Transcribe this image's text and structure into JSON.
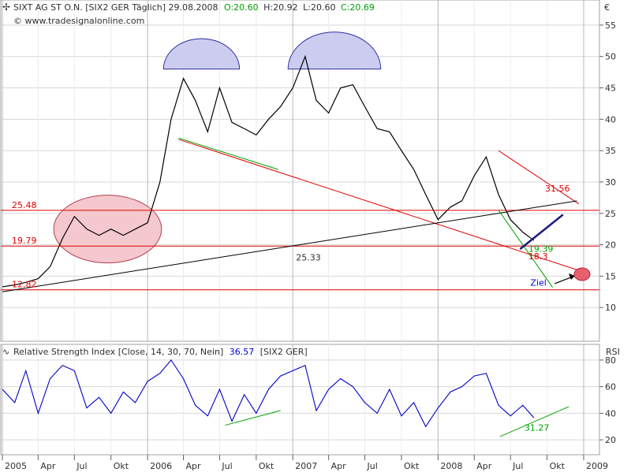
{
  "header": {
    "icon": "cross-cursor-icon",
    "title": "SIXT AG ST O.N. [SIX2 GER  Täglich] 29.08.2008",
    "ohlc": [
      {
        "text": "O:20.60",
        "color": "#00a000"
      },
      {
        "text": "H:20.92",
        "color": "#303030"
      },
      {
        "text": "L:20.60",
        "color": "#303030"
      },
      {
        "text": "C:20.69",
        "color": "#00a000"
      }
    ],
    "source": "© www.tradesignalonline.com",
    "currency": "€"
  },
  "price_axis": {
    "ticks": [
      10,
      15,
      20,
      25,
      30,
      35,
      40,
      45,
      50,
      55
    ]
  },
  "rsi_header": {
    "icon": "indicator-icon",
    "title": "Relative Strength Index [Close, 14, 30, 70, Nein]",
    "value": "36.57",
    "symbol": "[SIX2 GER]",
    "axis_title": "RSI"
  },
  "rsi_axis": {
    "ticks": [
      20,
      40,
      60,
      80
    ]
  },
  "time_axis": {
    "labels": [
      "2005",
      "Apr",
      "Jul",
      "Okt",
      "2006",
      "Apr",
      "Jul",
      "Okt",
      "2007",
      "Apr",
      "Jul",
      "Okt",
      "2008",
      "Apr",
      "Jul",
      "Okt",
      "2009"
    ]
  },
  "colors": {
    "price": "#000000",
    "rsi": "#0000c8",
    "support": "#e00000",
    "trend": "#00a000",
    "ellipse": "#f4c8cc",
    "cap": "#ccccf0"
  },
  "chart_data": [
    {
      "type": "line",
      "title": "SIXT AG ST O.N. [SIX2 GER  Täglich] 29.08.2008",
      "x_range": [
        "2005-01-01",
        "2009-01-01"
      ],
      "ylim": [
        5,
        58
      ],
      "series": [
        {
          "name": "SIXT AG ST O.N.",
          "points": [
            [
              "2005-01-01",
              13.3
            ],
            [
              "2005-02-01",
              13.6
            ],
            [
              "2005-03-01",
              14.0
            ],
            [
              "2005-04-01",
              14.6
            ],
            [
              "2005-05-01",
              16.5
            ],
            [
              "2005-06-01",
              21.0
            ],
            [
              "2005-07-01",
              24.5
            ],
            [
              "2005-08-01",
              22.5
            ],
            [
              "2005-09-01",
              21.5
            ],
            [
              "2005-10-01",
              22.5
            ],
            [
              "2005-11-01",
              21.5
            ],
            [
              "2005-12-01",
              22.5
            ],
            [
              "2006-01-01",
              23.5
            ],
            [
              "2006-02-01",
              30.0
            ],
            [
              "2006-03-01",
              40.0
            ],
            [
              "2006-04-01",
              46.5
            ],
            [
              "2006-05-01",
              43.0
            ],
            [
              "2006-06-01",
              38.0
            ],
            [
              "2006-07-01",
              45.0
            ],
            [
              "2006-08-01",
              39.5
            ],
            [
              "2006-09-01",
              38.5
            ],
            [
              "2006-10-01",
              37.5
            ],
            [
              "2006-11-01",
              40.0
            ],
            [
              "2006-12-01",
              42.0
            ],
            [
              "2007-01-01",
              45.0
            ],
            [
              "2007-02-01",
              50.0
            ],
            [
              "2007-03-01",
              43.0
            ],
            [
              "2007-04-01",
              41.0
            ],
            [
              "2007-05-01",
              45.0
            ],
            [
              "2007-06-01",
              45.5
            ],
            [
              "2007-07-01",
              42.0
            ],
            [
              "2007-08-01",
              38.5
            ],
            [
              "2007-09-01",
              38.0
            ],
            [
              "2007-10-01",
              35.0
            ],
            [
              "2007-11-01",
              32.0
            ],
            [
              "2007-12-01",
              28.0
            ],
            [
              "2008-01-01",
              24.0
            ],
            [
              "2008-02-01",
              26.0
            ],
            [
              "2008-03-01",
              27.0
            ],
            [
              "2008-04-01",
              31.0
            ],
            [
              "2008-05-01",
              34.0
            ],
            [
              "2008-06-01",
              28.0
            ],
            [
              "2008-07-01",
              24.0
            ],
            [
              "2008-08-01",
              22.0
            ],
            [
              "2008-08-29",
              20.69
            ]
          ]
        }
      ],
      "horizontal_lines": [
        {
          "value": 25.48,
          "label": "25.48",
          "color": "#e00000"
        },
        {
          "value": 19.79,
          "label": "19.79",
          "color": "#e00000"
        },
        {
          "value": 12.82,
          "label": "12.82",
          "color": "#e00000"
        }
      ],
      "trend_lines": [
        {
          "from": [
            "2008-06-01",
            35.0
          ],
          "to": [
            "2008-12-20",
            26.5
          ],
          "label": "31.56",
          "color": "#e00000"
        },
        {
          "from": [
            "2006-03-20",
            36.8
          ],
          "to": [
            "2008-12-25",
            15.8
          ],
          "color": "#e00000"
        },
        {
          "from": [
            "2005-01-01",
            12.5
          ],
          "to": [
            "2008-12-15",
            27.0
          ],
          "label": "25.33",
          "color": "#000000"
        },
        {
          "from": [
            "2006-03-20",
            37.0
          ],
          "to": [
            "2006-11-25",
            32.0
          ],
          "color": "#00a000"
        },
        {
          "from": [
            "2008-06-01",
            25.5
          ],
          "to": [
            "2008-10-15",
            13.2
          ],
          "color": "#00a000"
        },
        {
          "from": [
            "2008-07-25",
            19.3
          ],
          "to": [
            "2008-11-10",
            24.8
          ],
          "color": "#1a1a80"
        }
      ],
      "annotations": [
        {
          "text": "19.39",
          "x": "2008-08-15",
          "y": 19.4,
          "color": "#00a000"
        },
        {
          "text": "18.3",
          "x": "2008-08-15",
          "y": 18.2,
          "color": "#e00000"
        },
        {
          "text": "Ziel",
          "x": "2008-08-20",
          "y": 14.0,
          "color": "#0000c8"
        }
      ]
    },
    {
      "type": "line",
      "title": "Relative Strength Index [Close, 14, 30, 70, Nein]",
      "ylim": [
        10,
        90
      ],
      "series": [
        {
          "name": "RSI",
          "points": [
            [
              "2005-01-01",
              58
            ],
            [
              "2005-02-01",
              48
            ],
            [
              "2005-03-01",
              72
            ],
            [
              "2005-04-01",
              40
            ],
            [
              "2005-05-01",
              66
            ],
            [
              "2005-06-01",
              76
            ],
            [
              "2005-07-01",
              72
            ],
            [
              "2005-08-01",
              44
            ],
            [
              "2005-09-01",
              52
            ],
            [
              "2005-10-01",
              40
            ],
            [
              "2005-11-01",
              56
            ],
            [
              "2005-12-01",
              48
            ],
            [
              "2006-01-01",
              64
            ],
            [
              "2006-02-01",
              70
            ],
            [
              "2006-03-01",
              80
            ],
            [
              "2006-04-01",
              66
            ],
            [
              "2006-05-01",
              46
            ],
            [
              "2006-06-01",
              38
            ],
            [
              "2006-07-01",
              58
            ],
            [
              "2006-08-01",
              34
            ],
            [
              "2006-09-01",
              54
            ],
            [
              "2006-10-01",
              40
            ],
            [
              "2006-11-01",
              58
            ],
            [
              "2006-12-01",
              68
            ],
            [
              "2007-01-01",
              72
            ],
            [
              "2007-02-01",
              76
            ],
            [
              "2007-03-01",
              42
            ],
            [
              "2007-04-01",
              58
            ],
            [
              "2007-05-01",
              66
            ],
            [
              "2007-06-01",
              60
            ],
            [
              "2007-07-01",
              48
            ],
            [
              "2007-08-01",
              40
            ],
            [
              "2007-09-01",
              58
            ],
            [
              "2007-10-01",
              38
            ],
            [
              "2007-11-01",
              48
            ],
            [
              "2007-12-01",
              30
            ],
            [
              "2008-01-01",
              44
            ],
            [
              "2008-02-01",
              56
            ],
            [
              "2008-03-01",
              60
            ],
            [
              "2008-04-01",
              68
            ],
            [
              "2008-05-01",
              70
            ],
            [
              "2008-06-01",
              46
            ],
            [
              "2008-07-01",
              38
            ],
            [
              "2008-08-01",
              46
            ],
            [
              "2008-08-29",
              36.57
            ]
          ]
        }
      ],
      "trend_lines": [
        {
          "from": [
            "2006-07-15",
            31.0
          ],
          "to": [
            "2006-12-01",
            42.0
          ],
          "color": "#00a000"
        },
        {
          "from": [
            "2008-06-05",
            22.5
          ],
          "to": [
            "2008-11-25",
            45.0
          ],
          "label": "31.27",
          "color": "#00a000"
        }
      ]
    }
  ]
}
